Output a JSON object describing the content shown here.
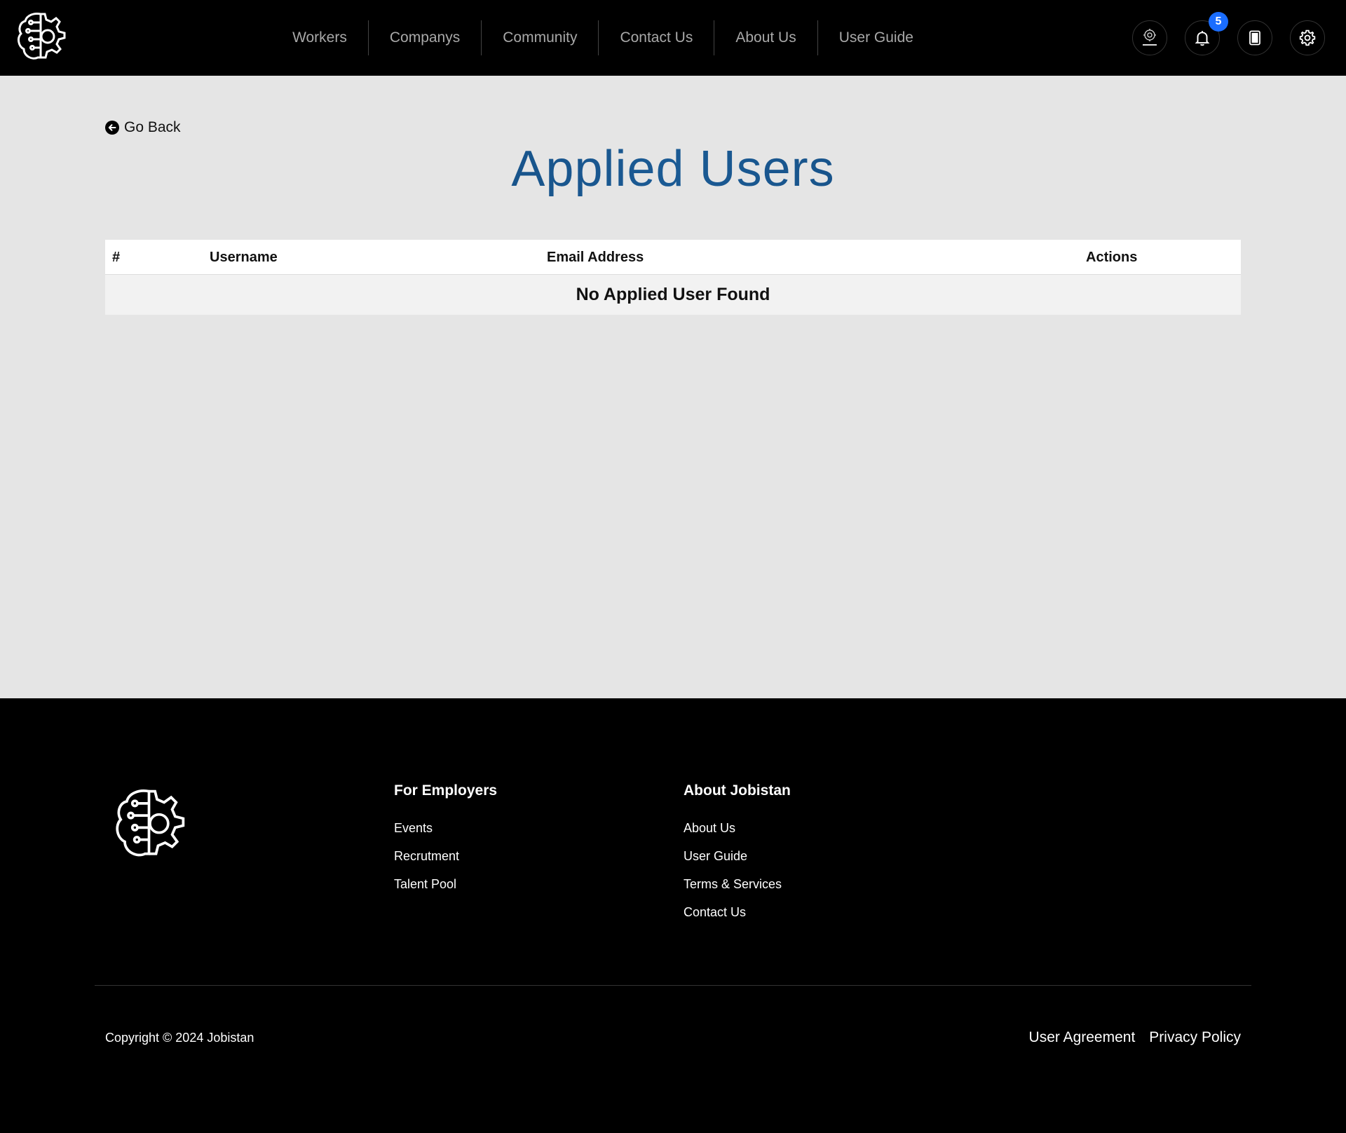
{
  "header": {
    "nav": [
      "Workers",
      "Companys",
      "Community",
      "Contact Us",
      "About Us",
      "User Guide"
    ],
    "notification_count": "5"
  },
  "main": {
    "go_back": "Go Back",
    "title": "Applied Users",
    "table": {
      "headers": [
        "#",
        "Username",
        "Email Address",
        "Actions"
      ],
      "empty_message": "No Applied User Found"
    }
  },
  "footer": {
    "employers": {
      "heading": "For Employers",
      "links": [
        "Events",
        "Recrutment",
        "Talent Pool"
      ]
    },
    "about": {
      "heading": "About Jobistan",
      "links": [
        "About Us",
        "User Guide",
        "Terms & Services",
        "Contact Us"
      ]
    },
    "copyright": "Copyright © 2024 Jobistan",
    "bottom_links": [
      "User Agreement",
      "Privacy Policy"
    ]
  },
  "colors": {
    "header_bg": "#000000",
    "page_bg": "#e5e5e5",
    "title": "#1a5a94",
    "badge": "#1a6dff"
  }
}
